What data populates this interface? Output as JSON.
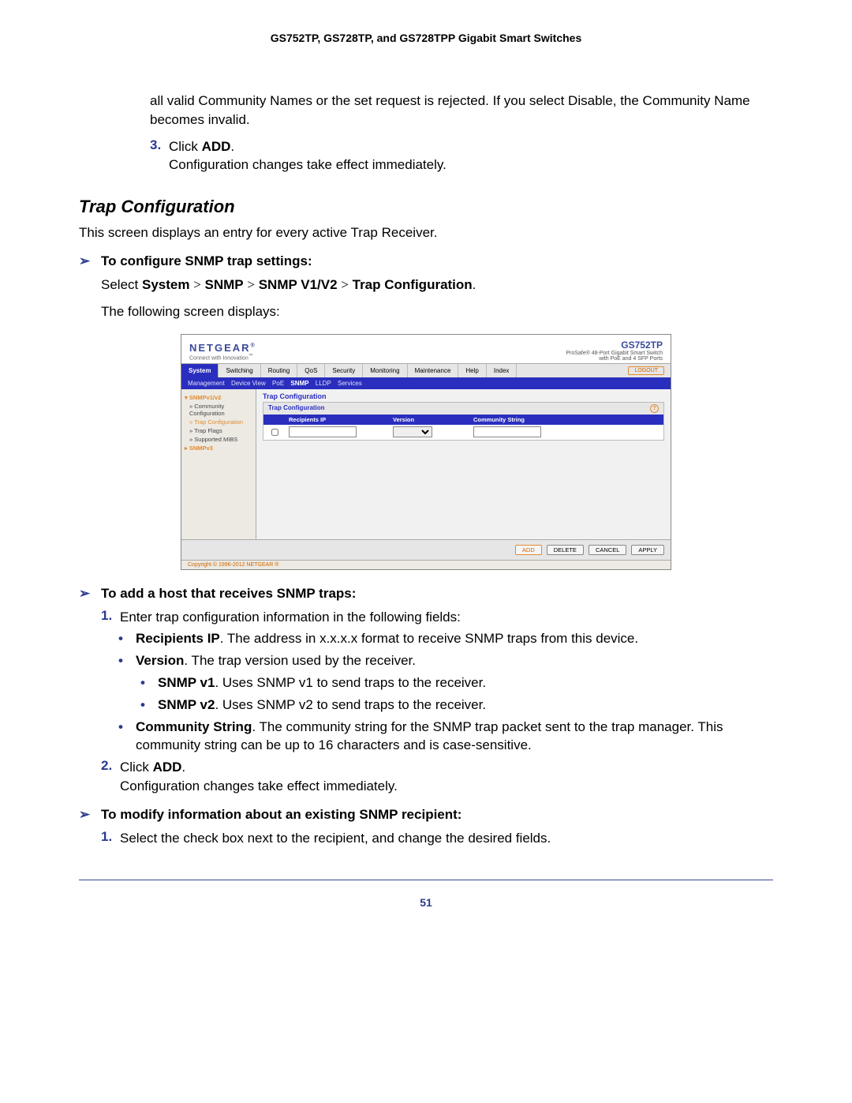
{
  "header": {
    "title": "GS752TP, GS728TP, and GS728TPP Gigabit Smart Switches"
  },
  "intro_para": "all valid Community Names or the set request is rejected. If you select Disable, the Community Name becomes invalid.",
  "step3": {
    "num": "3.",
    "text_prefix": "Click ",
    "bold": "ADD",
    "text_suffix": ".",
    "followup": "Configuration changes take effect immediately."
  },
  "section_title": "Trap Configuration",
  "section_desc": "This screen displays an entry for every active Trap Receiver.",
  "task1": {
    "arrow": "➢",
    "title": "To configure SNMP trap settings:",
    "select_prefix": "Select ",
    "path": [
      "System",
      "SNMP",
      "SNMP V1/V2",
      "Trap Configuration"
    ],
    "select_suffix": ".",
    "after": "The following screen displays:"
  },
  "netgear": {
    "brand": "NETGEAR",
    "tagline": "Connect with Innovation",
    "model": "GS752TP",
    "model_sub1": "ProSafe® 48-Port Gigabit Smart Switch",
    "model_sub2": "with PoE and 4 SFP Ports",
    "tabs": [
      "System",
      "Switching",
      "Routing",
      "QoS",
      "Security",
      "Monitoring",
      "Maintenance",
      "Help",
      "Index"
    ],
    "logout": "LOGOUT",
    "subtabs": [
      "Management",
      "Device View",
      "PoE",
      "SNMP",
      "LLDP",
      "Services"
    ],
    "side": {
      "group1": "SNMPv1/v2",
      "items": [
        "Community Configuration",
        "Trap Configuration",
        "Trap Flags",
        "Supported MIBS"
      ],
      "group2": "SNMPv3"
    },
    "panel_title": "Trap Configuration",
    "panel_inner": "Trap Configuration",
    "cols": {
      "ip": "Recipients IP",
      "ver": "Version",
      "cs": "Community String"
    },
    "buttons": {
      "add": "ADD",
      "delete": "DELETE",
      "cancel": "CANCEL",
      "apply": "APPLY"
    },
    "copyright": "Copyright © 1996-2012 NETGEAR ®"
  },
  "task2": {
    "arrow": "➢",
    "title": "To add a host that receives SNMP traps:"
  },
  "add_step1": {
    "num": "1.",
    "text": "Enter trap configuration information in the following fields:"
  },
  "bullets": {
    "ip": {
      "label": "Recipients IP",
      "text": ". The address in x.x.x.x format to receive SNMP traps from this device."
    },
    "ver": {
      "label": "Version",
      "text": ". The trap version used by the receiver."
    },
    "v1": {
      "label": "SNMP v1",
      "text": ". Uses SNMP v1 to send traps to the receiver."
    },
    "v2": {
      "label": "SNMP v2",
      "text": ". Uses SNMP v2 to send traps to the receiver."
    },
    "cs": {
      "label": "Community String",
      "text": ". The community string for the SNMP trap packet sent to the trap manager. This community string can be up to 16 characters and is case-sensitive."
    }
  },
  "add_step2": {
    "num": "2.",
    "text_prefix": "Click ",
    "bold": "ADD",
    "text_suffix": ".",
    "followup": "Configuration changes take effect immediately."
  },
  "task3": {
    "arrow": "➢",
    "title": "To modify information about an existing SNMP recipient:"
  },
  "mod_step1": {
    "num": "1.",
    "text": "Select the check box next to the recipient, and change the desired fields."
  },
  "page_num": "51"
}
